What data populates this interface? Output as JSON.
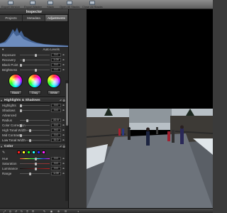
{
  "toolbar": {
    "items": [
      {
        "label": "Export Version",
        "icon": "export-version-icon"
      },
      {
        "label": "Export Master",
        "icon": "export-master-icon"
      },
      {
        "label": "Stack",
        "icon": "stack-icon"
      },
      {
        "label": "Open All Stacks",
        "icon": "open-stacks-icon"
      },
      {
        "label": "Close All Stacks",
        "icon": "close-stacks-icon"
      }
    ]
  },
  "inspector": {
    "title": "Inspector",
    "tabs": [
      "Projects",
      "Metadata",
      "Adjustments"
    ],
    "auto_levels": "Auto Levels",
    "rows_top": [
      {
        "label": "Exposure",
        "value": "0.0"
      },
      {
        "label": "Recovery",
        "value": "1.00"
      },
      {
        "label": "Black Point",
        "value": "0.0"
      },
      {
        "label": "Brightness",
        "value": "0.0"
      }
    ],
    "wheel_buttons": [
      "Black",
      "Gray",
      "White"
    ],
    "highlights_title": "Highlights & Shadows",
    "highlights_rows": [
      {
        "label": "Highlights",
        "value": "0.0"
      },
      {
        "label": "Shadows",
        "value": "0.0"
      },
      {
        "label": "Advanced",
        "value": ""
      },
      {
        "label": "Radius",
        "value": "22.5"
      },
      {
        "label": "Color Correction",
        "value": "0.0"
      },
      {
        "label": "High Tonal Width",
        "value": "9.0"
      },
      {
        "label": "Mid Contrast",
        "value": "0.0"
      },
      {
        "label": "Low Tonal Width",
        "value": "11.0"
      }
    ],
    "color_title": "Color",
    "color_rows": [
      {
        "label": "Hue",
        "value": "0.0"
      },
      {
        "label": "Saturation",
        "value": "0.0"
      },
      {
        "label": "Luminance",
        "value": "0.0"
      },
      {
        "label": "Range",
        "value": "1.00"
      }
    ],
    "swatch_colors": [
      "#ff2020",
      "#ffff20",
      "#20ff20",
      "#20ffff",
      "#3030ff",
      "#ff20ff"
    ]
  },
  "colors": {
    "panel_bg": "#2c2c2c",
    "viewer_bg": "#3a3a3a",
    "accent_tab": "#6a6a6a"
  }
}
